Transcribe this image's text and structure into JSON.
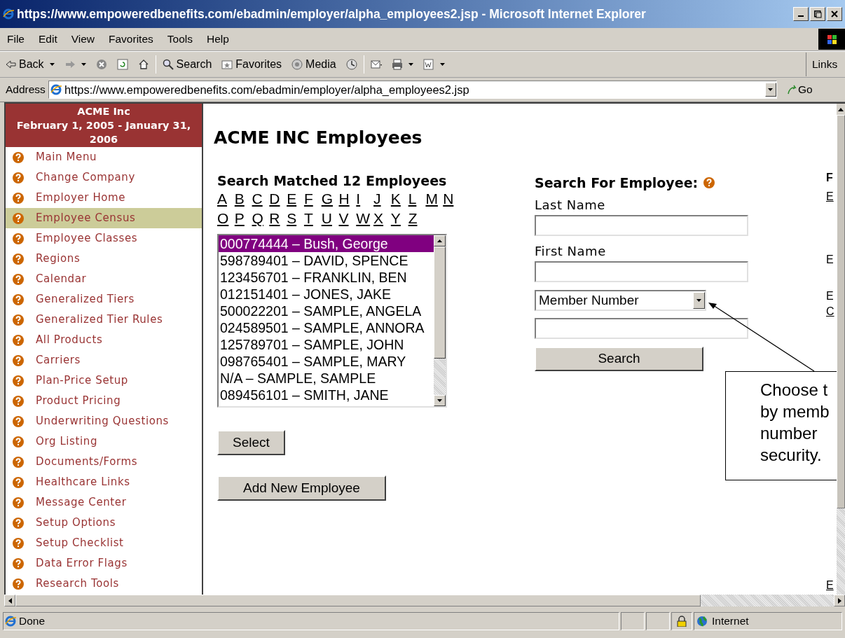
{
  "window": {
    "title": "https://www.empoweredbenefits.com/ebadmin/employer/alpha_employees2.jsp - Microsoft Internet Explorer"
  },
  "menu": [
    "File",
    "Edit",
    "View",
    "Favorites",
    "Tools",
    "Help"
  ],
  "toolbar": [
    {
      "kind": "back",
      "label": "Back"
    },
    {
      "kind": "forward"
    },
    {
      "kind": "stop"
    },
    {
      "kind": "refresh"
    },
    {
      "kind": "home"
    },
    {
      "kind": "search",
      "label": "Search"
    },
    {
      "kind": "favorites",
      "label": "Favorites"
    },
    {
      "kind": "media",
      "label": "Media"
    },
    {
      "kind": "history"
    },
    {
      "kind": "mail"
    },
    {
      "kind": "print"
    },
    {
      "kind": "edit"
    }
  ],
  "links": "Links",
  "address": {
    "label": "Address",
    "url": "https://www.empoweredbenefits.com/ebadmin/employer/alpha_employees2.jsp",
    "go": "Go"
  },
  "sidebar": {
    "company": "ACME Inc",
    "period": "February 1, 2005 - January 31, 2006",
    "items": [
      {
        "label": "Main Menu",
        "selected": false
      },
      {
        "label": "Change Company",
        "selected": false
      },
      {
        "label": "Employer Home",
        "selected": false
      },
      {
        "label": "Employee Census",
        "selected": true
      },
      {
        "label": "Employee Classes",
        "selected": false
      },
      {
        "label": "Regions",
        "selected": false
      },
      {
        "label": "Calendar",
        "selected": false
      },
      {
        "label": "Generalized Tiers",
        "selected": false
      },
      {
        "label": "Generalized Tier Rules",
        "selected": false
      },
      {
        "label": "All Products",
        "selected": false
      },
      {
        "label": "Carriers",
        "selected": false
      },
      {
        "label": "Plan-Price Setup",
        "selected": false
      },
      {
        "label": "Product Pricing",
        "selected": false
      },
      {
        "label": "Underwriting Questions",
        "selected": false
      },
      {
        "label": "Org Listing",
        "selected": false
      },
      {
        "label": "Documents/Forms",
        "selected": false
      },
      {
        "label": "Healthcare Links",
        "selected": false
      },
      {
        "label": "Message Center",
        "selected": false
      },
      {
        "label": "Setup Options",
        "selected": false
      },
      {
        "label": "Setup Checklist",
        "selected": false
      },
      {
        "label": "Data Error Flags",
        "selected": false
      },
      {
        "label": "Research Tools",
        "selected": false
      }
    ]
  },
  "heading": "ACME INC Employees",
  "results": {
    "title": "Search Matched 12 Employees",
    "letters": [
      "A",
      "B",
      "C",
      "D",
      "E",
      "F",
      "G",
      "H",
      "I",
      "J",
      "K",
      "L",
      "M",
      "N",
      "O",
      "P",
      "Q",
      "R",
      "S",
      "T",
      "U",
      "V",
      "W",
      "X",
      "Y",
      "Z"
    ],
    "employees": [
      {
        "label": "000774444 – Bush, George",
        "selected": true
      },
      {
        "label": "598789401 – DAVID, SPENCE",
        "selected": false
      },
      {
        "label": "123456701 – FRANKLIN, BEN",
        "selected": false
      },
      {
        "label": "012151401 – JONES, JAKE",
        "selected": false
      },
      {
        "label": "500022201 – SAMPLE, ANGELA",
        "selected": false
      },
      {
        "label": "024589501 – SAMPLE, ANNORA",
        "selected": false
      },
      {
        "label": "125789701 – SAMPLE, JOHN",
        "selected": false
      },
      {
        "label": "098765401 – SAMPLE, MARY",
        "selected": false
      },
      {
        "label": "N/A – SAMPLE, SAMPLE",
        "selected": false
      },
      {
        "label": "089456101 – SMITH, JANE",
        "selected": false
      }
    ],
    "select_button": "Select",
    "add_button": "Add New Employee"
  },
  "search_form": {
    "title": "Search For Employee:",
    "last_name": {
      "label": "Last Name"
    },
    "first_name": {
      "label": "First Name"
    },
    "id_type": {
      "value": "Member Number"
    },
    "search_button": "Search"
  },
  "right_column": [
    {
      "kind": "heading",
      "text": "F"
    },
    {
      "kind": "link",
      "text": "E"
    },
    {
      "kind": "text",
      "text": "E"
    },
    {
      "kind": "text",
      "text": "E"
    },
    {
      "kind": "link",
      "text": "C"
    },
    {
      "kind": "link",
      "text": "E"
    }
  ],
  "callout": {
    "lines": [
      "Choose t",
      "by memb",
      "number",
      "security."
    ]
  },
  "status_bar": {
    "text": "Done",
    "zone": "Internet"
  }
}
